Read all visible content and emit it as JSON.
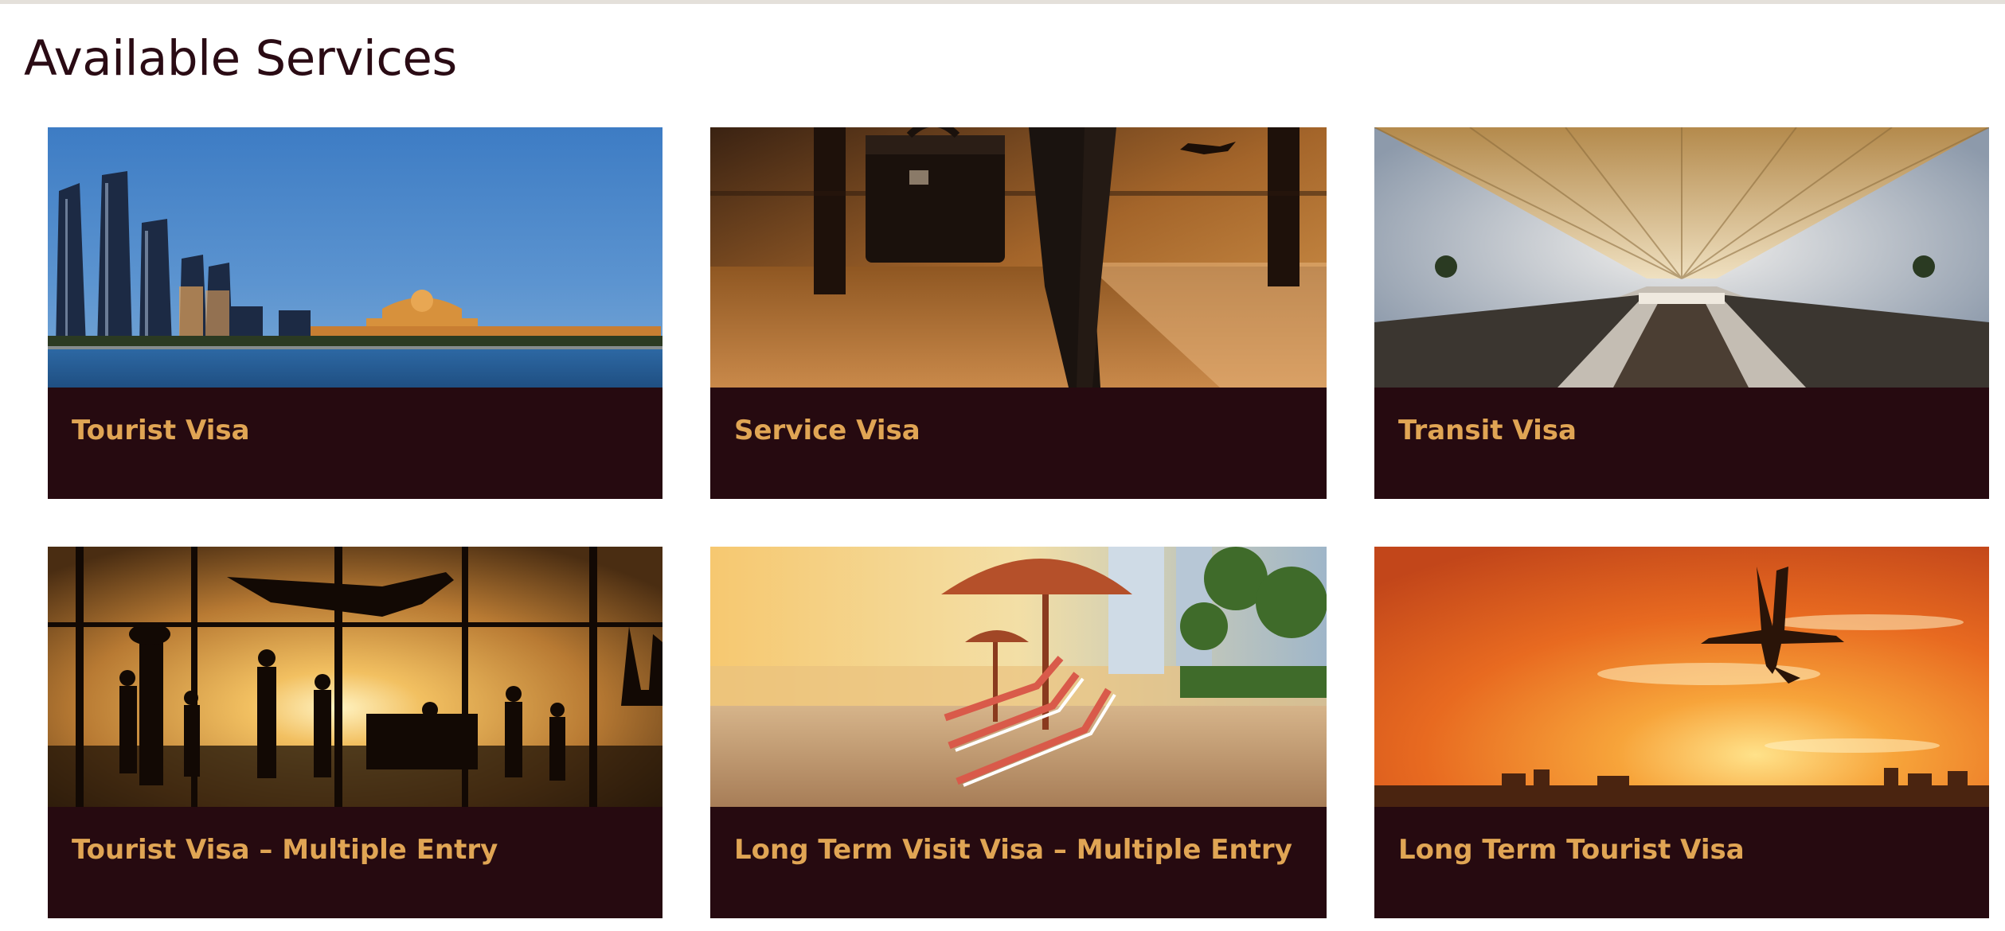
{
  "page": {
    "title": "Available Services"
  },
  "services": [
    {
      "label": "Tourist Visa",
      "image": "abu-dhabi-skyline"
    },
    {
      "label": "Service Visa",
      "image": "traveler-briefcase-airport"
    },
    {
      "label": "Transit Visa",
      "image": "airport-terminal-corridor"
    },
    {
      "label": "Tourist Visa – Multiple Entry",
      "image": "airport-silhouettes-plane"
    },
    {
      "label": "Long Term Visit Visa – Multiple Entry",
      "image": "beach-loungers-umbrellas"
    },
    {
      "label": "Long Term Tourist Visa",
      "image": "plane-orange-sunset"
    }
  ],
  "colors": {
    "title": "#2a0b14",
    "card_footer": "#260a10",
    "card_label": "#e0a554"
  }
}
